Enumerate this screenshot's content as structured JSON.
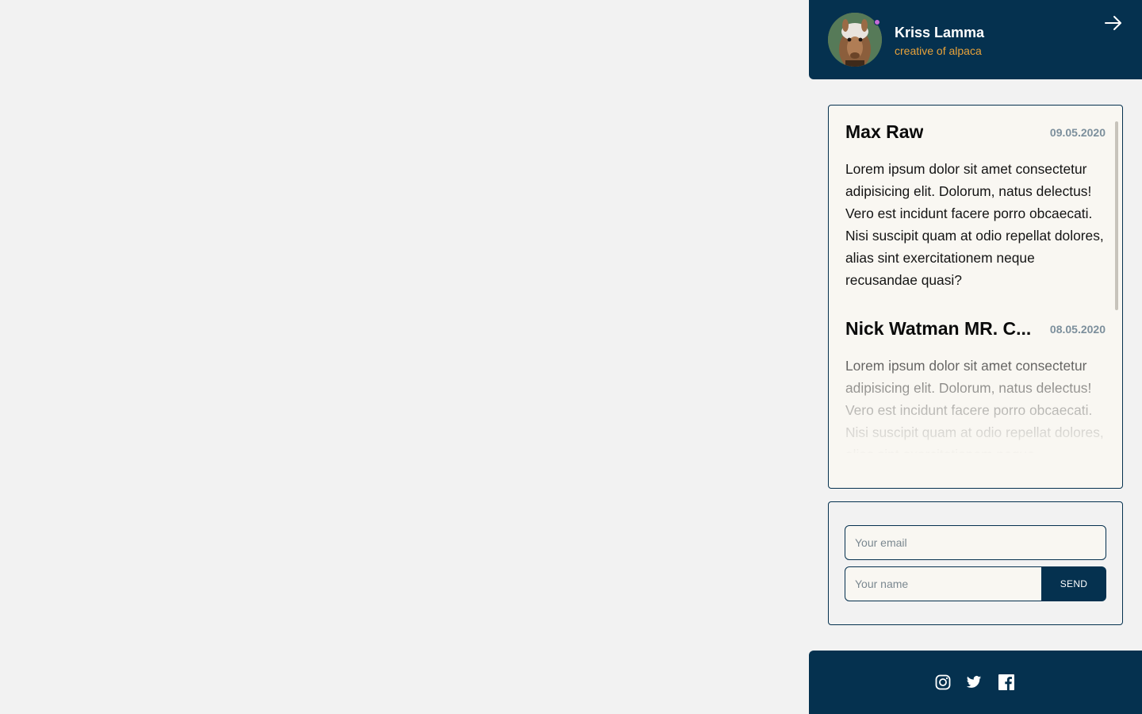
{
  "profile": {
    "name": "Kriss Lamma",
    "role": "creative of alpaca",
    "status_color": "#c56bd6",
    "avatar_icon": "alpaca-avatar",
    "logout_icon": "arrow-right-icon"
  },
  "comments": [
    {
      "author": "Max Raw",
      "date": "09.05.2020",
      "text": "Lorem ipsum dolor sit amet consectetur adipisicing elit. Dolorum, natus delectus! Vero est incidunt facere porro obcaecati. Nisi suscipit quam at odio repellat dolores, alias sint exercitationem neque recusandae quasi?"
    },
    {
      "author": "Nick Watman MR. C...",
      "date": "08.05.2020",
      "text": "Lorem ipsum dolor sit amet consectetur adipisicing elit. Dolorum, natus delectus! Vero est incidunt facere porro obcaecati. Nisi suscipit quam at odio repellat dolores, alias sint exercitationem neque"
    }
  ],
  "form": {
    "email_placeholder": "Your email",
    "name_placeholder": "Your name",
    "send_label": "SEND"
  },
  "footer": {
    "social": [
      "instagram-icon",
      "twitter-icon",
      "facebook-icon"
    ]
  },
  "colors": {
    "background": "#f2f2f2",
    "navy": "#05314f",
    "accent": "#e8a23a",
    "card": "#f9f7f2"
  }
}
